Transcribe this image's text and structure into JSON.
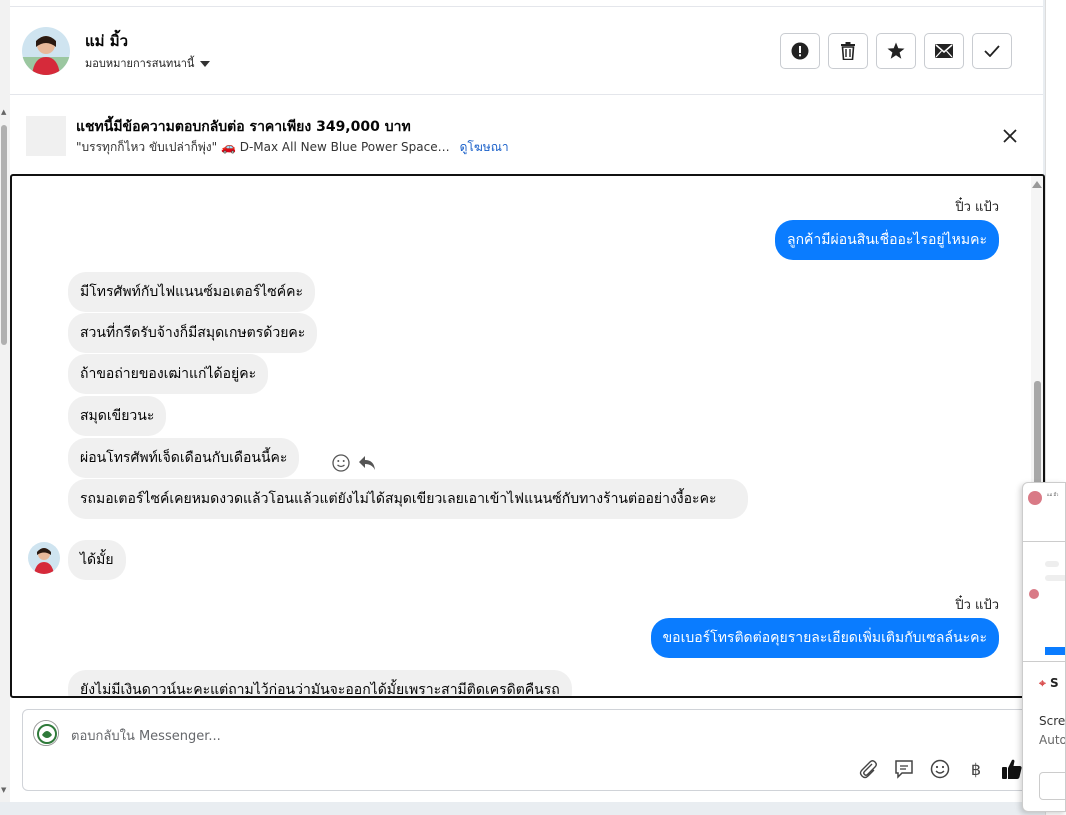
{
  "header": {
    "contact_name": "แม่ มิ้ว",
    "assign_label": "มอบหมายการสนทนานี้",
    "actions": [
      {
        "name": "report-button",
        "icon": "exclamation-circle-icon"
      },
      {
        "name": "delete-button",
        "icon": "trash-icon"
      },
      {
        "name": "star-button",
        "icon": "star-icon"
      },
      {
        "name": "mark-unread-button",
        "icon": "envelope-icon"
      },
      {
        "name": "mark-done-button",
        "icon": "check-icon"
      }
    ]
  },
  "ad": {
    "title": "แชทนี้มีข้อความตอบกลับต่อ ราคาเพียง 349,000 บาท",
    "subtitle": "\"บรรทุกก็ไหว ขับเปล่าก็พุ่ง\" 🚗 D-Max All New Blue Power Space…",
    "link": "ดูโฆษณา",
    "close_icon": "close-icon"
  },
  "messages": {
    "sender_1": "ปิ๋ว แป้ว",
    "out_1": "ลูกค้ามีผ่อนสินเชื่ออะไรอยู่ไหมคะ",
    "in_1": "มีโทรศัพท์กับไฟแนนซ์มอเตอร์ไซค์คะ",
    "in_2": "สวนที่กรีดรับจ้างก็มีสมุดเกษตรด้วยคะ",
    "in_3": "ถ้าขอถ่ายของเฒ่าแก่ได้อยู่คะ",
    "in_4": "สมุดเขียวนะ",
    "in_5": "ผ่อนโทรศัพท์เจ็ดเดือนกับเดือนนี้คะ",
    "in_6": "รถมอเตอร์ไซค์เคยหมดงวดแล้วโอนแล้วแต่ยังไม่ได้สมุดเขียวเลยเอาเข้าไฟแนนซ์กับทางร้านต่ออย่างงี้อะคะ",
    "in_7": "ได้มั้ย",
    "sender_2": "ปิ๋ว แป้ว",
    "out_2": "ขอเบอร์โทรติดต่อคุยรายละเอียดเพิ่มเติมกับเซลล์นะคะ",
    "in_8": "ยังไม่มีเงินดาวน์นะคะแต่ถามไว้ก่อนว่ามันจะออกได้มั้ยเพราะสามีติดเครดิตคืนรถ"
  },
  "composer": {
    "placeholder": "ตอบกลับใน Messenger...",
    "tools": [
      "paperclip-icon",
      "saved-reply-icon",
      "emoji-icon",
      "baht-icon",
      "thumbs-up-icon"
    ]
  },
  "float_card": {
    "text_1": "Scre",
    "text_2": "Auto",
    "letter": "S",
    "mini_name": "แม่ มิ้ว"
  },
  "colors": {
    "outgoing_bubble": "#0a7cff",
    "incoming_bubble": "#f0f0f0",
    "link": "#1a60c9"
  }
}
